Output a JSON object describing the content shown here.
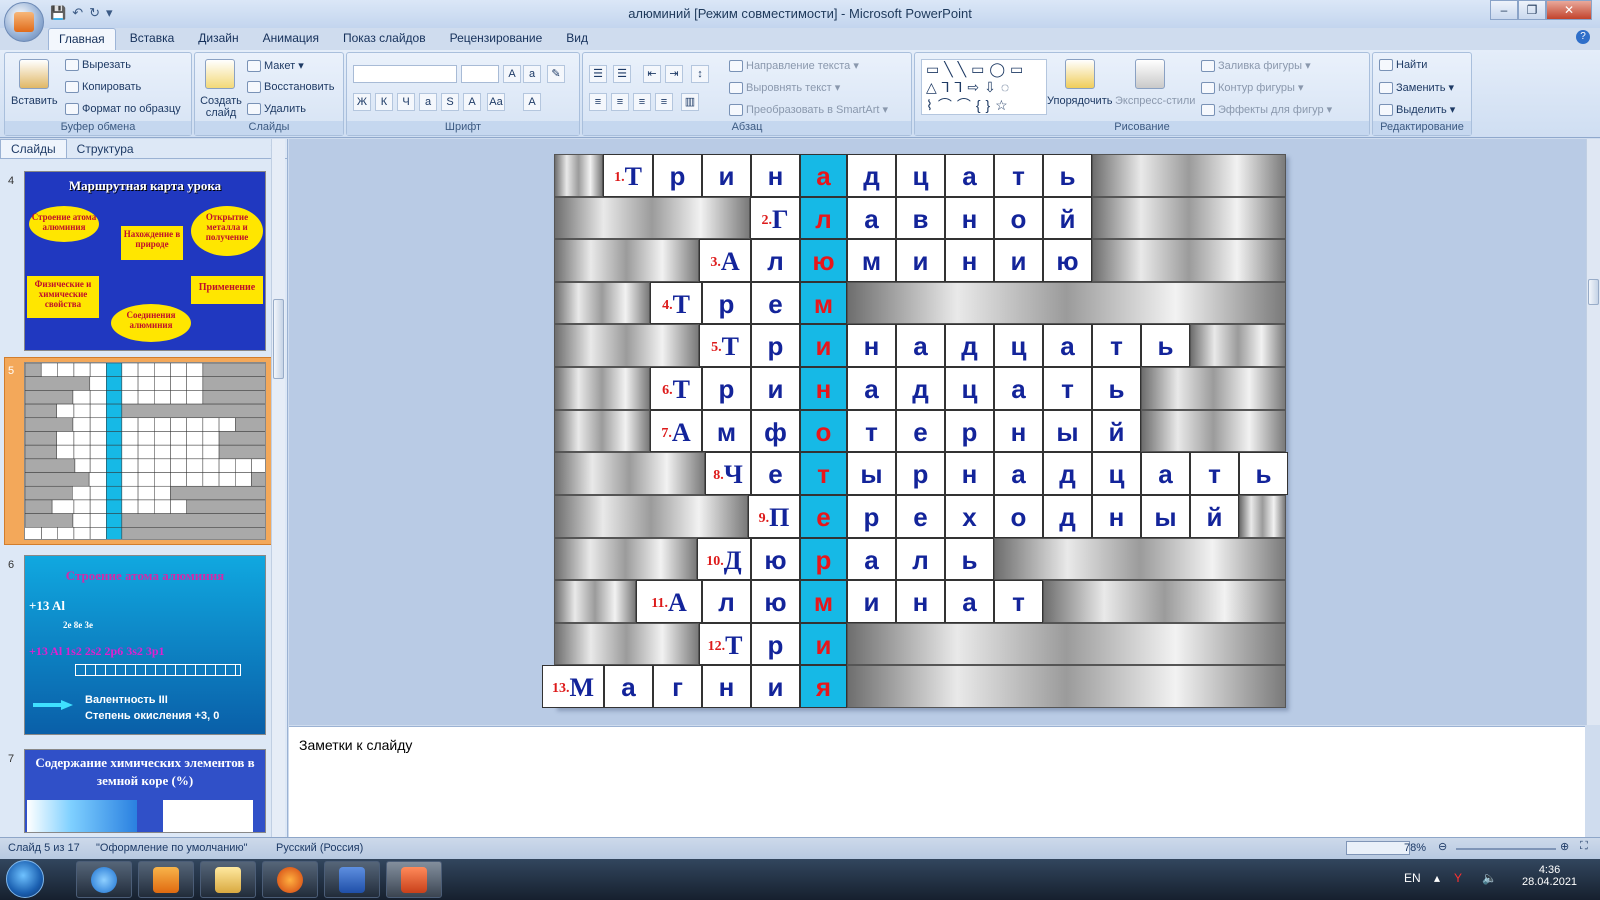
{
  "window": {
    "title": "алюминий [Режим совместимости] - Microsoft PowerPoint",
    "controls": [
      "–",
      "❐",
      "✕"
    ]
  },
  "ribbon_tabs": [
    "Главная",
    "Вставка",
    "Дизайн",
    "Анимация",
    "Показ слайдов",
    "Рецензирование",
    "Вид"
  ],
  "ribbon": {
    "clipboard": {
      "label": "Буфер обмена",
      "paste": "Вставить",
      "cut": "Вырезать",
      "copy": "Копировать",
      "format": "Формат по образцу"
    },
    "slides": {
      "label": "Слайды",
      "new_slide": "Создать слайд",
      "layout": "Макет",
      "reset": "Восстановить",
      "delete": "Удалить"
    },
    "font": {
      "label": "Шрифт"
    },
    "paragraph": {
      "label": "Абзац",
      "text_dir": "Направление текста",
      "align_text": "Выровнять текст",
      "smartart": "Преобразовать в SmartArt"
    },
    "drawing": {
      "label": "Рисование",
      "arrange": "Упорядочить",
      "quick_styles": "Экспресс-стили",
      "fill": "Заливка фигуры",
      "outline": "Контур фигуры",
      "effects": "Эффекты для фигур"
    },
    "editing": {
      "label": "Редактирование",
      "find": "Найти",
      "replace": "Заменить",
      "select": "Выделить"
    }
  },
  "left_panel": {
    "tabs": [
      "Слайды",
      "Структура"
    ],
    "close": "×",
    "slide_numbers": [
      "4",
      "5",
      "6",
      "7"
    ],
    "slide4": {
      "title": "Маршрутная карта урока",
      "items": [
        "Строение атома алюминия",
        "Нахождение в природе",
        "Открытие металла и получение",
        "Физические и химические свойства",
        "Применение",
        "Соединения алюминия"
      ]
    },
    "slide6": {
      "title": "Строение атома алюминия",
      "line1": "+13 Al",
      "line2": "2e 8e 3e",
      "line3": "+13 Al 1s2 2s2 2p6 3s2 3p1",
      "valence": "Валентность    III",
      "oxidation": "Степень окисления    +3, 0"
    },
    "slide7": {
      "title": "Содержание химических элементов в земной коре (%)"
    }
  },
  "crossword": {
    "rows": [
      {
        "num": "1.",
        "cap": "Т",
        "letters": [
          "р",
          "и",
          "н",
          "а",
          "д",
          "ц",
          "а",
          "т",
          "ь"
        ]
      },
      {
        "num": "2.",
        "cap": "Г",
        "letters": [
          "л",
          "а",
          "в",
          "н",
          "о",
          "й"
        ]
      },
      {
        "num": "3.",
        "cap": "А",
        "letters": [
          "л",
          "ю",
          "м",
          "и",
          "н",
          "и",
          "ю"
        ]
      },
      {
        "num": "4.",
        "cap": "Т",
        "letters": [
          "р",
          "е",
          "м"
        ]
      },
      {
        "num": "5.",
        "cap": "Т",
        "letters": [
          "р",
          "и",
          "н",
          "а",
          "д",
          "ц",
          "а",
          "т",
          "ь"
        ]
      },
      {
        "num": "6.",
        "cap": "Т",
        "letters": [
          "р",
          "и",
          "н",
          "а",
          "д",
          "ц",
          "а",
          "т",
          "ь"
        ]
      },
      {
        "num": "7.",
        "cap": "А",
        "letters": [
          "м",
          "ф",
          "о",
          "т",
          "е",
          "р",
          "н",
          "ы",
          "й"
        ]
      },
      {
        "num": "8.",
        "cap": "Ч",
        "letters": [
          "е",
          "т",
          "ы",
          "р",
          "н",
          "а",
          "д",
          "ц",
          "а",
          "т",
          "ь"
        ]
      },
      {
        "num": "9.",
        "cap": "П",
        "letters": [
          "е",
          "р",
          "е",
          "х",
          "о",
          "д",
          "н",
          "ы",
          "й"
        ]
      },
      {
        "num": "10.",
        "cap": "Д",
        "letters": [
          "ю",
          "р",
          "а",
          "л",
          "ь"
        ]
      },
      {
        "num": "11.",
        "cap": "А",
        "letters": [
          "л",
          "ю",
          "м",
          "и",
          "н",
          "а",
          "т"
        ]
      },
      {
        "num": "12.",
        "cap": "Т",
        "letters": [
          "р",
          "и"
        ]
      },
      {
        "num": "13.",
        "cap": "М",
        "letters": [
          "а",
          "г",
          "н",
          "и",
          "я"
        ]
      }
    ],
    "key_word": "алюминотермия"
  },
  "notes": {
    "placeholder": "Заметки к слайду"
  },
  "status": {
    "slide": "Слайд 5 из 17",
    "theme": "\"Оформление по умолчанию\"",
    "language": "Русский (Россия)",
    "zoom": "78%"
  },
  "taskbar": {
    "lang": "EN",
    "time": "4:36",
    "date": "28.04.2021"
  },
  "colors": {
    "key_column": "#16b9e6",
    "letters": "#13249a",
    "key_letters": "#e8161a",
    "numbers": "#dd1a1a"
  }
}
